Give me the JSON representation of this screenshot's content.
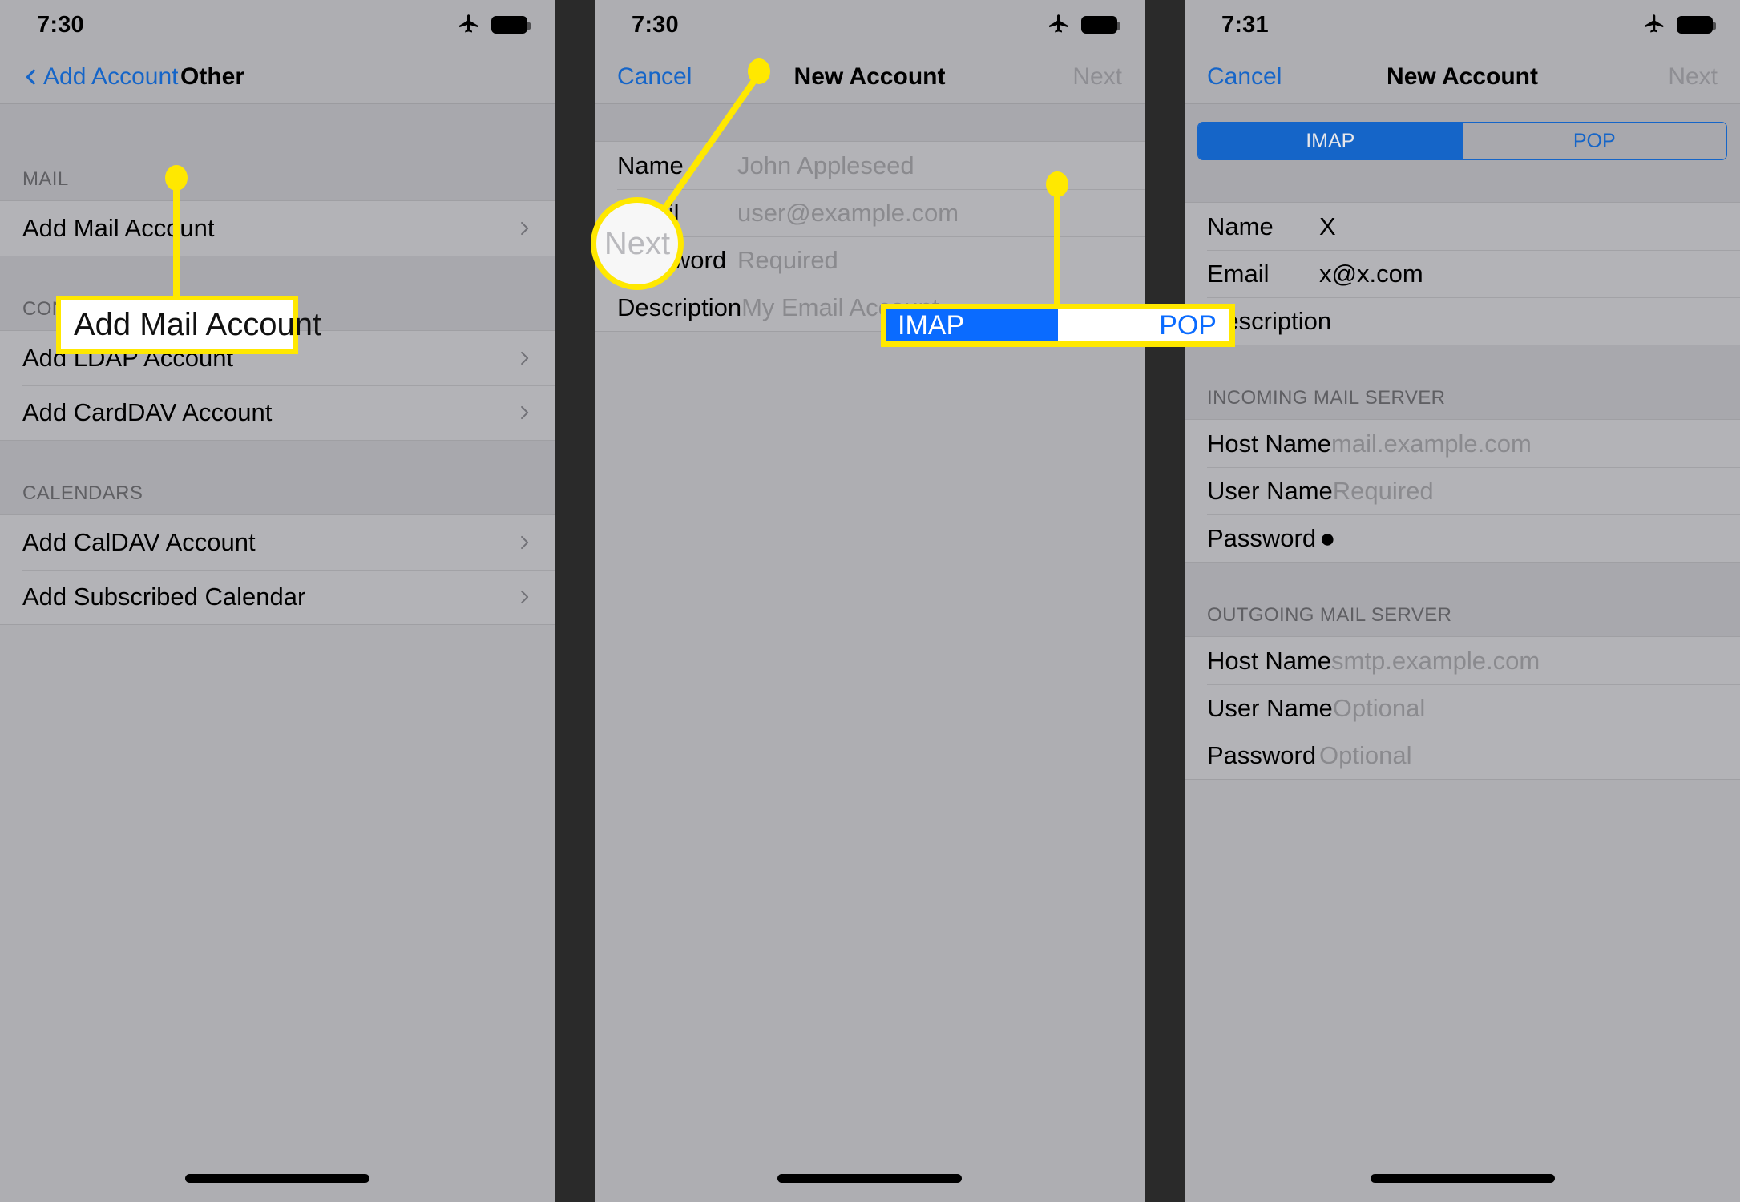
{
  "panels": [
    {
      "status": {
        "time": "7:30",
        "airplane_icon": "airplane-icon",
        "battery_icon": "battery-full-icon"
      },
      "nav": {
        "back_label": "Add Account",
        "title": "Other",
        "back_icon": "chevron-left-icon"
      },
      "sections": [
        {
          "header": "MAIL",
          "rows": [
            {
              "label": "Add Mail Account",
              "accessory": "chevron-right-icon"
            }
          ]
        },
        {
          "header": "CONTACTS",
          "rows": [
            {
              "label": "Add LDAP Account",
              "accessory": "chevron-right-icon"
            },
            {
              "label": "Add CardDAV Account",
              "accessory": "chevron-right-icon"
            }
          ]
        },
        {
          "header": "CALENDARS",
          "rows": [
            {
              "label": "Add CalDAV Account",
              "accessory": "chevron-right-icon"
            },
            {
              "label": "Add Subscribed Calendar",
              "accessory": "chevron-right-icon"
            }
          ]
        }
      ],
      "callout": {
        "text": "Add Mail Account"
      }
    },
    {
      "status": {
        "time": "7:30",
        "airplane_icon": "airplane-icon",
        "battery_icon": "battery-full-icon"
      },
      "nav": {
        "cancel_label": "Cancel",
        "title": "New Account",
        "next_label": "Next"
      },
      "fields": [
        {
          "label": "Name",
          "value": "John Appleseed"
        },
        {
          "label": "Email",
          "value": "user@example.com"
        },
        {
          "label": "Password",
          "value": "Required"
        },
        {
          "label": "Description",
          "value": "My Email Account"
        }
      ],
      "callout": {
        "text": "Next"
      }
    },
    {
      "status": {
        "time": "7:31",
        "airplane_icon": "airplane-icon",
        "battery_icon": "battery-full-icon"
      },
      "nav": {
        "cancel_label": "Cancel",
        "title": "New Account",
        "next_label": "Next"
      },
      "segment": {
        "options": [
          "IMAP",
          "POP"
        ],
        "selected": "IMAP"
      },
      "account_fields": [
        {
          "label": "Name",
          "value": "X",
          "filled": true
        },
        {
          "label": "Email",
          "value": "x@x.com",
          "filled": true
        },
        {
          "label": "Description",
          "value": "",
          "filled": true
        }
      ],
      "incoming": {
        "header": "INCOMING MAIL SERVER",
        "fields": [
          {
            "label": "Host Name",
            "value": "mail.example.com"
          },
          {
            "label": "User Name",
            "value": "Required"
          },
          {
            "label": "Password",
            "value": "●",
            "filled": true
          }
        ]
      },
      "outgoing": {
        "header": "OUTGOING MAIL SERVER",
        "fields": [
          {
            "label": "Host Name",
            "value": "smtp.example.com"
          },
          {
            "label": "User Name",
            "value": "Optional"
          },
          {
            "label": "Password",
            "value": "Optional"
          }
        ]
      },
      "callout": {
        "left": "IMAP",
        "right": "POP"
      }
    }
  ],
  "colors": {
    "highlight": "#ffe800",
    "accent_blue": "#1565c8",
    "segment_selected": "#0a6bff",
    "panel_bg": "#aeaeb2",
    "row_bg": "#b3b3b7"
  }
}
